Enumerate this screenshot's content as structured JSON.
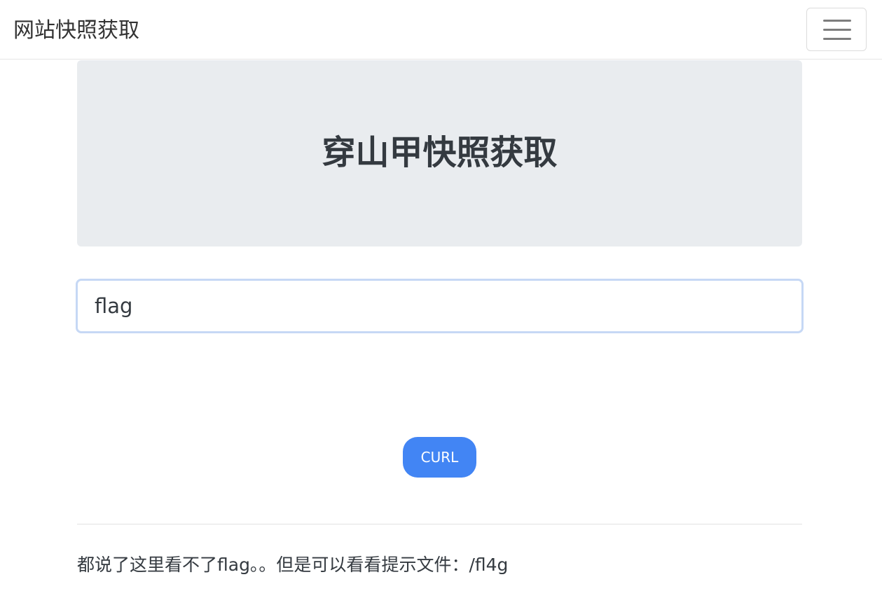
{
  "navbar": {
    "brand": "网站快照获取",
    "toggler_icon": "hamburger-menu-icon"
  },
  "jumbotron": {
    "title": "穿山甲快照获取"
  },
  "form": {
    "url_value": "flag",
    "submit_label": "CURL",
    "submit_color": "#4285f4"
  },
  "footer": {
    "hint": "都说了这里看不了flag。。但是可以看看提示文件：/fl4g"
  }
}
